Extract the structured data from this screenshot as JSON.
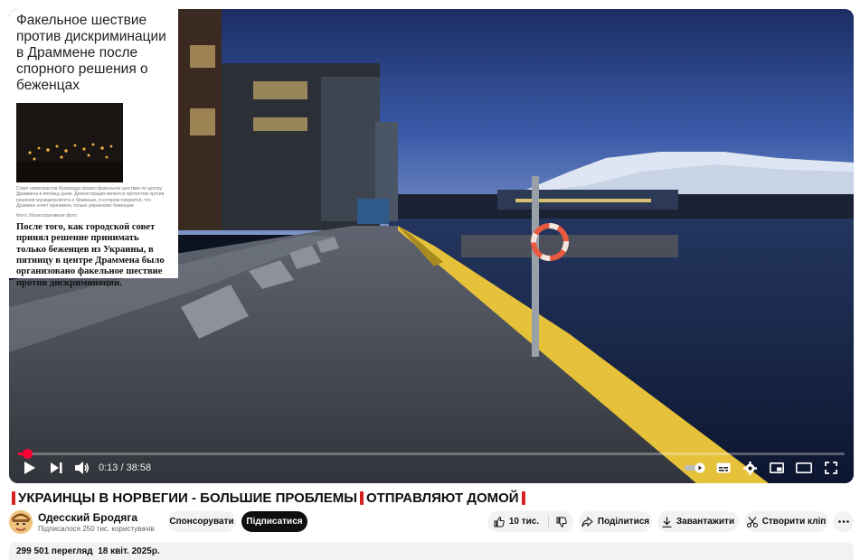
{
  "overlay": {
    "headline": "Факельное шествие против дискриминации в Драммене после спорного решения о беженцах",
    "caption": "Совет иммигрантов Бускеруда провел факельное шествие по центру Драммена в пятницу днем. Демонстрация является протестом против решения муниципалитета о беженцах, в котором говорится, что Драммен хочет принимать только украинских беженцев.",
    "photo_credit": "Фото: Иллюстративное фото",
    "body": "После того, как городской совет принял решение принимать только беженцев из Украины, в пятницу в центре Драммена было организовано факельное шествие против дискриминации."
  },
  "player": {
    "time": "0:13 / 38:58",
    "progress": 0.0056,
    "icons": [
      "play-icon",
      "next-icon",
      "volume-icon",
      "autoplay-toggle-icon",
      "subtitles-icon",
      "settings-icon",
      "miniplayer-icon",
      "theater-icon",
      "fullscreen-icon"
    ]
  },
  "video": {
    "title": "УКРАИНЦЫ В НОРВЕГИИ - БОЛЬШИЕ ПРОБЛЕМЫ",
    "title_tail": "ОТПРАВЛЯЮТ ДОМОЙ",
    "views_date": "299 501 перегляд  18 квіт. 2025р."
  },
  "channel": {
    "name": "Одесский Бродяга",
    "subscribers": "Підписалося 250 тис. користувачів",
    "sponsor_label": "Спонсорувати",
    "subscribe_label": "Підписатися"
  },
  "actions": {
    "likes": "10 тис.",
    "share_label": "Поділитися",
    "download_label": "Завантажити",
    "clip_label": "Створити кліп",
    "more_icon": "more-icon"
  },
  "colors": {
    "accent": "#ff0033",
    "title_mark": "#d32020",
    "pill_bg": "#f2f2f2",
    "subscribe_bg": "#0f0f0f"
  }
}
